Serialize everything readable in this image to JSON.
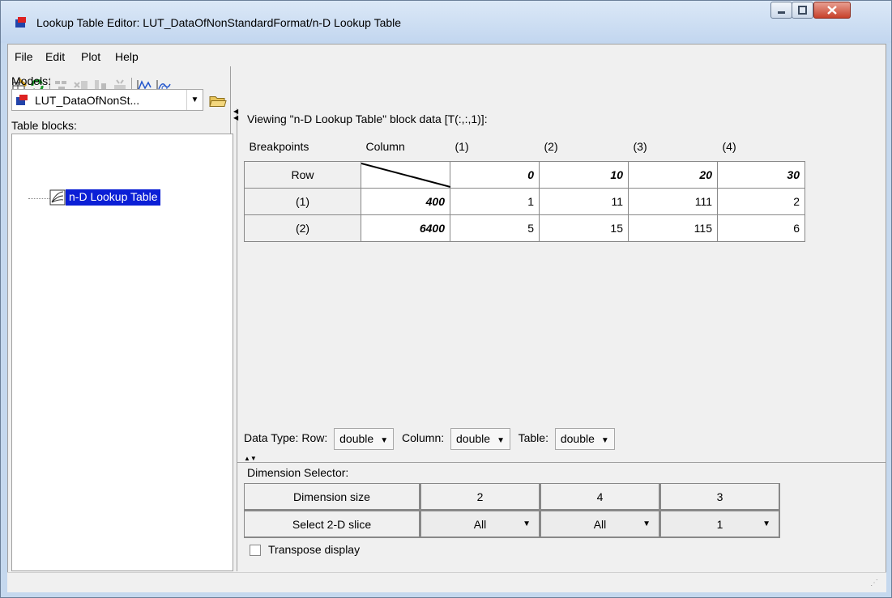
{
  "window": {
    "title": "Lookup Table Editor: LUT_DataOfNonStandardFormat/n-D Lookup Table"
  },
  "menu": [
    "File",
    "Edit",
    "Plot",
    "Help"
  ],
  "toolbar": {
    "icons": [
      "edit-data-icon",
      "refresh-icon",
      "tb-icon-1",
      "tb-icon-2",
      "tb-icon-3",
      "tb-icon-4",
      "line-plot-icon",
      "mesh-plot-icon"
    ]
  },
  "left": {
    "models_label": "Models:",
    "model_selected": "LUT_DataOfNonSt...",
    "table_blocks_label": "Table blocks:",
    "tree_item": "n-D Lookup Table"
  },
  "right": {
    "viewing": "Viewing \"n-D Lookup Table\" block data [T(:,:,1)]:",
    "header": [
      "Breakpoints",
      "Column",
      "(1)",
      "(2)",
      "(3)",
      "(4)"
    ],
    "row_header": "Row",
    "col_breakpoints": [
      "0",
      "10",
      "20",
      "30"
    ],
    "rows": [
      {
        "label": "(1)",
        "bp": "400",
        "values": [
          "1",
          "11",
          "111",
          "2"
        ]
      },
      {
        "label": "(2)",
        "bp": "6400",
        "values": [
          "5",
          "15",
          "115",
          "6"
        ]
      }
    ]
  },
  "datatype": {
    "label": "Data Type:",
    "row_label": "Row:",
    "row_value": "double",
    "col_label": "Column:",
    "col_value": "double",
    "table_label": "Table:",
    "table_value": "double"
  },
  "dimension": {
    "label": "Dimension Selector:",
    "size_label": "Dimension size",
    "sizes": [
      "2",
      "4",
      "3"
    ],
    "slice_label": "Select 2-D slice",
    "slices": [
      "All",
      "All",
      "1"
    ]
  },
  "transpose_label": "Transpose display"
}
